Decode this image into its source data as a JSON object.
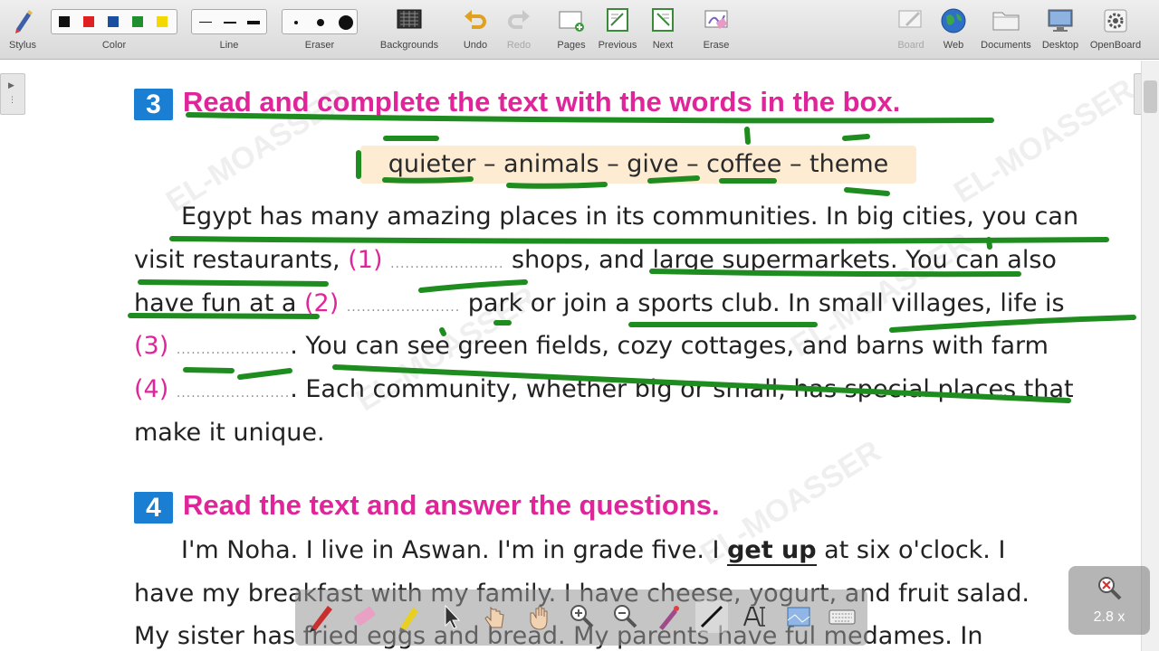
{
  "toolbar": {
    "stylus": "Stylus",
    "color": "Color",
    "line": "Line",
    "eraser": "Eraser",
    "backgrounds": "Backgrounds",
    "undo": "Undo",
    "redo": "Redo",
    "pages": "Pages",
    "previous": "Previous",
    "next": "Next",
    "erase": "Erase",
    "board": "Board",
    "web": "Web",
    "documents": "Documents",
    "desktop": "Desktop",
    "openboard": "OpenBoard",
    "colors": [
      "#111111",
      "#e02020",
      "#1a4fa0",
      "#1f8f2f",
      "#f5d800"
    ]
  },
  "exercise3": {
    "number": "3",
    "heading": "Read and complete the text with the words in the box.",
    "word_box": "quieter – animals – give – coffee – theme",
    "line1": "Egypt has many amazing places in its communities. In big cities, you can",
    "line2a": "visit restaurants,",
    "blank1": "(1)",
    "line2b": "shops, and large supermarkets. You can also",
    "line3a": "have fun at a",
    "blank2": "(2)",
    "line3b": "park or join a sports club. In small villages, life is",
    "blank3": "(3)",
    "line4b": ". You can see green fields, cozy cottages, and barns with farm",
    "blank4": "(4)",
    "line5b": ". Each community, whether big or small, has special places that",
    "line6": "make it unique."
  },
  "exercise4": {
    "number": "4",
    "heading": "Read the text and answer the questions.",
    "line1a": "I'm Noha. I live in Aswan. I'm in grade five. I",
    "line1bold": "get up",
    "line1b": "at six o'clock. I",
    "line2": "have my breakfast with my family. I have cheese, yogurt, and fruit salad.",
    "line3": "My sister has fried eggs and bread. My parents have ful medames. In"
  },
  "watermark": "EL-MOASSER",
  "zoom": {
    "level": "2.8 x"
  },
  "accent": {
    "ink": "#1e8c1e",
    "heading": "#e0249a",
    "number_box": "#1a7fd2",
    "word_box": "#fdecd2"
  }
}
